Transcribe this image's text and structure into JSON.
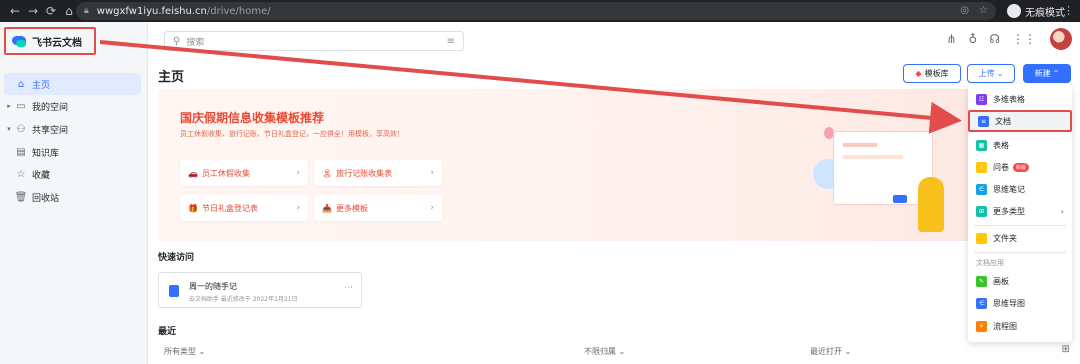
{
  "browser": {
    "url_host": "wwgxfw1iyu.feishu.cn",
    "url_path": "/drive/home/",
    "incognito_label": "无痕模式"
  },
  "sidebar": {
    "app_name": "飞书云文档",
    "items": [
      {
        "label": "主页",
        "icon": "home-icon"
      },
      {
        "label": "我的空间",
        "icon": "folder-icon"
      },
      {
        "label": "共享空间",
        "icon": "shared-icon"
      },
      {
        "label": "知识库",
        "icon": "book-icon"
      },
      {
        "label": "收藏",
        "icon": "star-icon"
      },
      {
        "label": "回收站",
        "icon": "trash-icon"
      }
    ]
  },
  "header": {
    "search_placeholder": "搜索",
    "title": "主页",
    "template_btn": "模板库",
    "upload_btn": "上传",
    "new_btn": "新建"
  },
  "banner": {
    "title": "国庆假期信息收集模板推荐",
    "subtitle": "员工休假收集、旅行记账、节日礼盒登记，一应俱全！用模板，享高效！",
    "templates": [
      {
        "label": "员工休假收集",
        "emoji": "🚗"
      },
      {
        "label": "旅行记账收集表",
        "emoji": "🏝"
      },
      {
        "label": "节日礼盒登记表",
        "emoji": "🎁"
      },
      {
        "label": "更多模板",
        "emoji": "📥"
      }
    ]
  },
  "quick_access": {
    "title": "快速访问",
    "card_name": "周一的随手记",
    "card_meta": "云文档助手 最近修改于 2022年1月21日"
  },
  "recent": {
    "title": "最近",
    "col_type": "所有类型",
    "col_owner": "不限归属",
    "col_opened": "最近打开"
  },
  "new_menu": {
    "items": [
      {
        "label": "多维表格",
        "color": "#7f3bf5"
      },
      {
        "label": "文档",
        "color": "#3370ff"
      },
      {
        "label": "表格",
        "color": "#14c0a6"
      },
      {
        "label": "问卷",
        "color": "#ffc60a",
        "badge": "新版"
      },
      {
        "label": "思维笔记",
        "color": "#14a2e6"
      },
      {
        "label": "更多类型",
        "color": "#14c0a6"
      },
      {
        "label": "文件夹",
        "color": "#ffc60a"
      }
    ],
    "group_label": "文档应用",
    "app_items": [
      {
        "label": "画板",
        "color": "#34c724"
      },
      {
        "label": "思维导图",
        "color": "#3370ff"
      },
      {
        "label": "流程图",
        "color": "#ff7d00"
      }
    ]
  },
  "colors": {
    "accent": "#3370ff",
    "highlight": "#e24c4b",
    "banner_text": "#e84b34"
  }
}
